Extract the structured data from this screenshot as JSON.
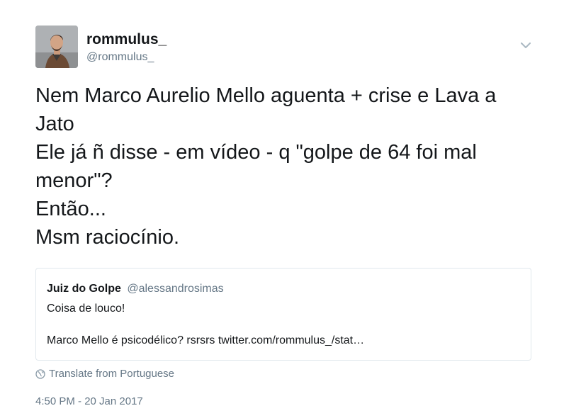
{
  "author": {
    "display_name": "rommulus_",
    "screen_name": "@rommulus_",
    "avatar_icon": "profile-photo"
  },
  "menu": {
    "icon": "chevron-down-icon"
  },
  "tweet": {
    "lines": [
      "Nem Marco Aurelio Mello aguenta + crise e Lava a",
      "Jato",
      "Ele já ñ disse - em vídeo - q \"golpe de 64 foi mal",
      "menor\"?",
      "Então...",
      "Msm raciocínio."
    ]
  },
  "quoted_tweet": {
    "display_name": "Juiz do Golpe",
    "screen_name": "@alessandrosimas",
    "line1": "Coisa de louco!",
    "line2": "Marco Mello é psicodélico? rsrsrs twitter.com/rommulus_/stat…"
  },
  "translate": {
    "label": "Translate from Portuguese",
    "icon": "globe-icon"
  },
  "timestamp": "4:50 PM - 20 Jan 2017",
  "colors": {
    "primary_text": "#14171a",
    "secondary_text": "#657786",
    "border": "#e1e8ed"
  }
}
